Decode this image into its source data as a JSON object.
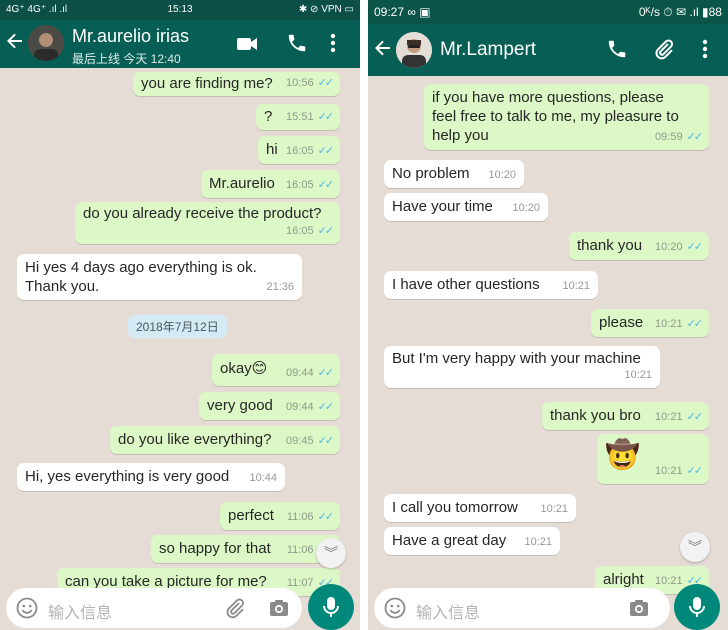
{
  "left": {
    "status": {
      "left": "4G⁺ 4G⁺ .ıl .ıl",
      "time": "15:13",
      "right": "✱ ⊘ VPN ▭"
    },
    "contact_name": "Mr.aurelio irias",
    "contact_status": "最后上线 今天 12:40",
    "input_placeholder": "输入信息",
    "date_chip": "2018年7月12日",
    "messages": [
      {
        "text": "you are finding me?",
        "time": "10:56"
      },
      {
        "text": "?",
        "time": "15:51"
      },
      {
        "text": "hi",
        "time": "16:05"
      },
      {
        "text": "Mr.aurelio",
        "time": "16:05"
      },
      {
        "text": "do you already receive the product?",
        "time": "16:05"
      },
      {
        "text": "Hi yes 4 days ago everything is ok.\nThank you.",
        "time": "21:36"
      },
      {
        "text": "okay😊",
        "time": "09:44"
      },
      {
        "text": "very good",
        "time": "09:44"
      },
      {
        "text": "do you like everything?",
        "time": "09:45"
      },
      {
        "text": "Hi, yes everything is very good",
        "time": "10:44"
      },
      {
        "text": "perfect",
        "time": "11:06"
      },
      {
        "text": "so happy for that",
        "time": "11:06"
      },
      {
        "text": "can you take a picture for me?",
        "time": "11:07"
      }
    ]
  },
  "right": {
    "status": {
      "left": "09:27 ∞ ▣",
      "right": "0ᴷ/s ⏱ ✉ .ıl ▮88"
    },
    "contact_name": "Mr.Lampert",
    "input_placeholder": "输入信息",
    "messages": [
      {
        "text": "if you have more questions, please\nfeel free to talk to me, my pleasure to\nhelp you",
        "time": "09:59"
      },
      {
        "text": "No problem",
        "time": "10:20"
      },
      {
        "text": "Have your time",
        "time": "10:20"
      },
      {
        "text": "thank you",
        "time": "10:20"
      },
      {
        "text": "I have other questions",
        "time": "10:21"
      },
      {
        "text": "please",
        "time": "10:21"
      },
      {
        "text": "But I'm very happy with your machine",
        "time": "10:21"
      },
      {
        "text": "thank you bro",
        "time": "10:21"
      },
      {
        "text": "🤠",
        "time": "10:21"
      },
      {
        "text": "I call you tomorrow",
        "time": "10:21"
      },
      {
        "text": "Have a great day",
        "time": "10:21"
      },
      {
        "text": "alright",
        "time": "10:21"
      }
    ]
  },
  "icons": {
    "back": "arrow-left-icon",
    "video": "video-call-icon",
    "phone": "phone-icon",
    "attach": "paperclip-icon",
    "more": "more-vert-icon",
    "emoji": "emoji-icon",
    "camera": "camera-icon",
    "mic": "mic-icon",
    "read": "double-check-icon",
    "scroll": "chevron-double-down-icon"
  },
  "colors": {
    "appbar": "#075e54",
    "outgoing_bubble": "#dcf8c6",
    "incoming_bubble": "#ffffff",
    "chat_bg": "#e5ddd5",
    "read_ticks": "#4fb6ec",
    "mic_button": "#00897b"
  }
}
